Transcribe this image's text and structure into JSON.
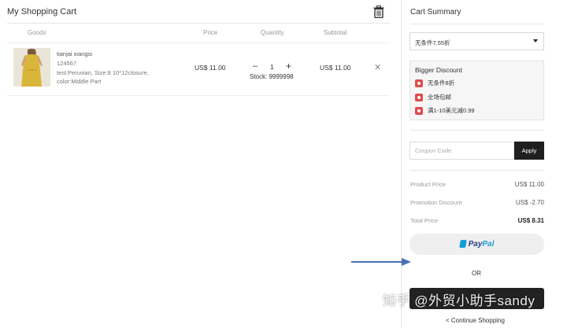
{
  "cart": {
    "title": "My Shopping Cart",
    "columns": {
      "goods": "Goods",
      "price": "Price",
      "quantity": "Quantity",
      "subtotal": "Subtotal"
    },
    "items": [
      {
        "name": "tianjai xiangsi",
        "sku": "124567",
        "options1": "test:Peruvian, Size:8 10*12closure,",
        "options2": "color:Middle Part",
        "price": "US$ 11.00",
        "quantity": "1",
        "stock": "Stock: 9999998",
        "subtotal": "US$ 11.00"
      }
    ]
  },
  "summary": {
    "title": "Cart Summary",
    "coupon_select": "无条件7.55折",
    "discount_box": {
      "title": "Bigger Discount",
      "items": [
        "无条件8折",
        "全场包邮",
        "满1-10美元减0.99"
      ]
    },
    "coupon_placeholder": "Coupon Code",
    "apply_label": "Apply",
    "rows": [
      {
        "label": "Product Price",
        "value": "US$ 11.00"
      },
      {
        "label": "Promotion Discount",
        "value": "US$ -2.70"
      },
      {
        "label": "Total Price",
        "value": "US$ 8.31"
      }
    ],
    "paypal": {
      "part1": "Pay",
      "part2": "Pal"
    },
    "or_label": "OR",
    "continue_label": "< Continue Shopping"
  },
  "watermark": "知乎 @外贸小助手sandy",
  "colors": {
    "arrow": "#4a6fb5",
    "tag": "#e04b4b",
    "paypal_blue": "#253b80",
    "paypal_light": "#179bd7",
    "checkout_bg": "#222222"
  },
  "icons": {
    "trash": "trash-icon",
    "remove": "close-icon",
    "caret": "caret-down-icon",
    "tag": "coupon-tag-icon",
    "paypal": "paypal-logo-icon",
    "arrow": "arrow-right-icon"
  }
}
